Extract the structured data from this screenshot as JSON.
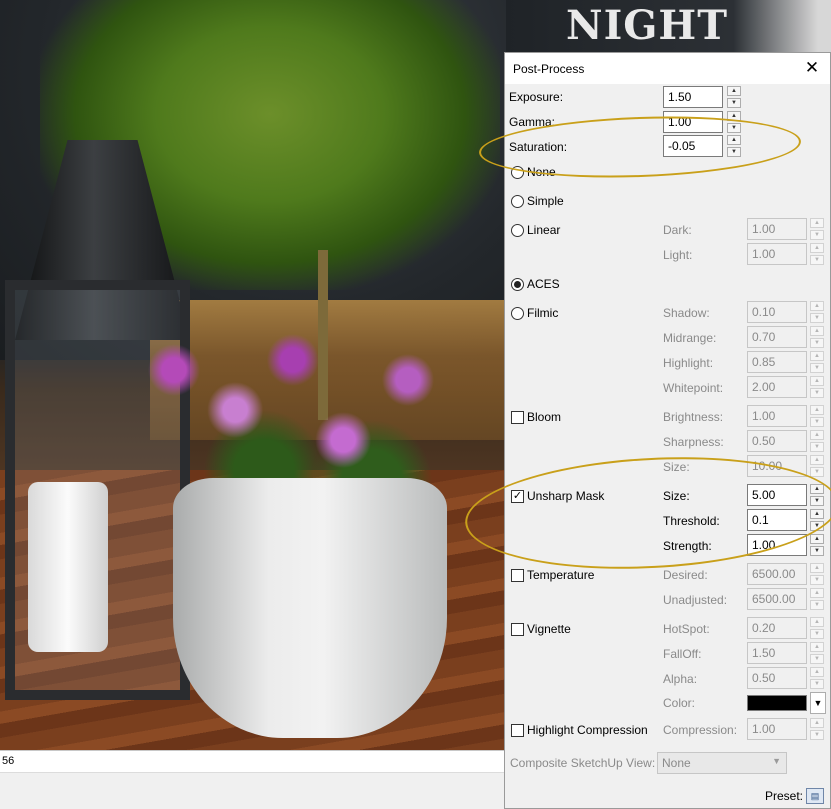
{
  "viewport": {
    "status_text": "56"
  },
  "background_sign": {
    "text": "NIGHT"
  },
  "dialog": {
    "title": "Post-Process",
    "close_glyph": "✕",
    "exposure": {
      "label": "Exposure:",
      "value": "1.50"
    },
    "gamma": {
      "label": "Gamma:",
      "value": "1.00"
    },
    "saturation": {
      "label": "Saturation:",
      "value": "-0.05"
    },
    "tonemap": {
      "none": {
        "label": "None",
        "selected": false
      },
      "simple": {
        "label": "Simple",
        "selected": false
      },
      "linear": {
        "label": "Linear",
        "selected": false,
        "dark": {
          "label": "Dark:",
          "value": "1.00"
        },
        "light": {
          "label": "Light:",
          "value": "1.00"
        }
      },
      "aces": {
        "label": "ACES",
        "selected": true
      },
      "filmic": {
        "label": "Filmic",
        "selected": false,
        "shadow": {
          "label": "Shadow:",
          "value": "0.10"
        },
        "midrange": {
          "label": "Midrange:",
          "value": "0.70"
        },
        "highlight": {
          "label": "Highlight:",
          "value": "0.85"
        },
        "whitepoint": {
          "label": "Whitepoint:",
          "value": "2.00"
        }
      }
    },
    "bloom": {
      "label": "Bloom",
      "checked": false,
      "brightness": {
        "label": "Brightness:",
        "value": "1.00"
      },
      "sharpness": {
        "label": "Sharpness:",
        "value": "0.50"
      },
      "size": {
        "label": "Size:",
        "value": "10.00"
      }
    },
    "unsharp": {
      "label": "Unsharp Mask",
      "checked": true,
      "check_glyph": "✓",
      "size": {
        "label": "Size:",
        "value": "5.00"
      },
      "threshold": {
        "label": "Threshold:",
        "value": "0.1"
      },
      "strength": {
        "label": "Strength:",
        "value": "1.00"
      }
    },
    "temperature": {
      "label": "Temperature",
      "checked": false,
      "desired": {
        "label": "Desired:",
        "value": "6500.00"
      },
      "unadjusted": {
        "label": "Unadjusted:",
        "value": "6500.00"
      }
    },
    "vignette": {
      "label": "Vignette",
      "checked": false,
      "hotspot": {
        "label": "HotSpot:",
        "value": "0.20"
      },
      "falloff": {
        "label": "FallOff:",
        "value": "1.50"
      },
      "alpha": {
        "label": "Alpha:",
        "value": "0.50"
      },
      "color": {
        "label": "Color:",
        "value_color": "#000000"
      }
    },
    "highlight_compression": {
      "label": "Highlight Compression",
      "checked": false,
      "compression": {
        "label": "Compression:",
        "value": "1.00"
      }
    },
    "composite": {
      "label": "Composite SketchUp View:",
      "value": "None"
    },
    "preset": {
      "label": "Preset:"
    }
  },
  "annotations": {
    "color": "#c9a01a"
  },
  "icons": {
    "spin_up": "▲",
    "spin_down": "▼",
    "dropdown": "▼",
    "preset": "▤"
  }
}
